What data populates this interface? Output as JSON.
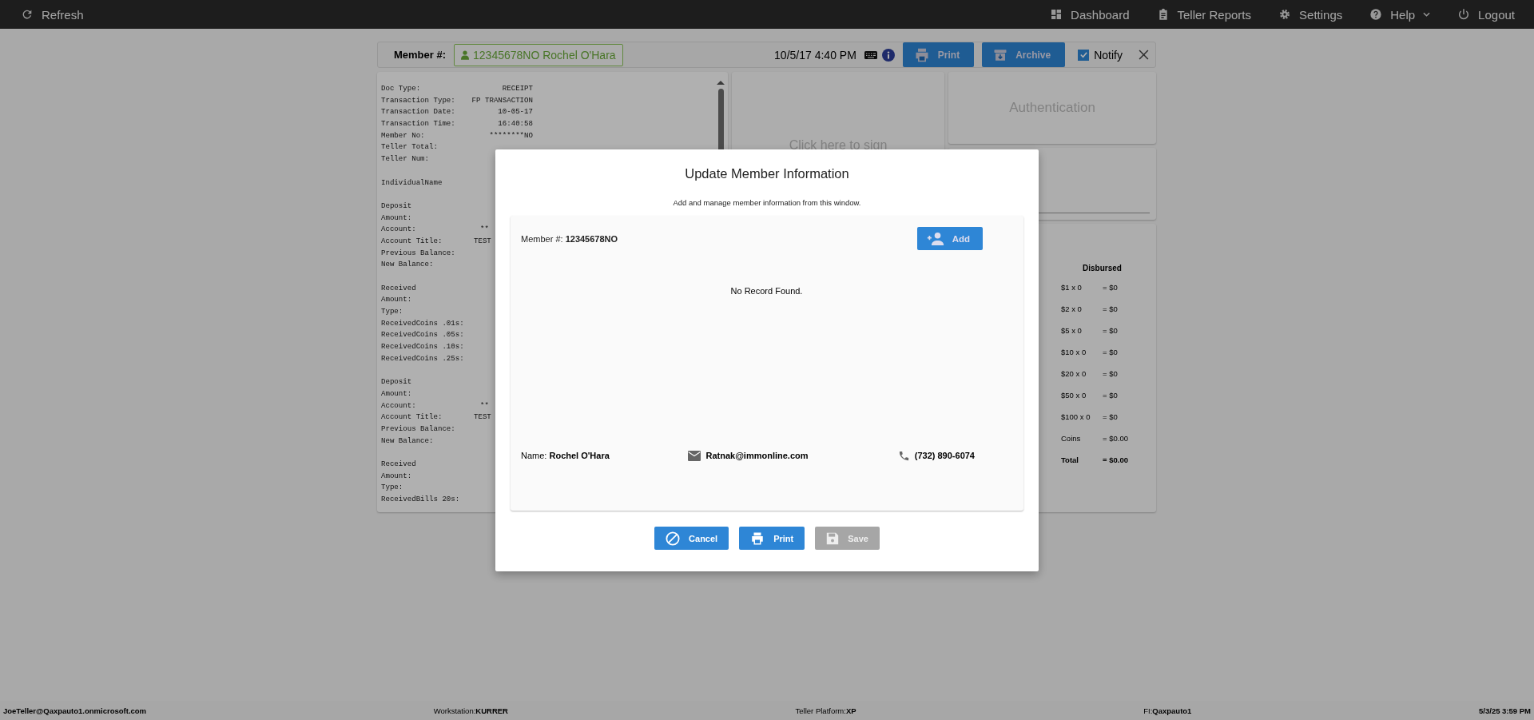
{
  "nav": {
    "left": [
      {
        "label": "Refresh"
      }
    ],
    "right": [
      {
        "label": "Dashboard",
        "has_menu": false
      },
      {
        "label": "Teller Reports",
        "has_menu": false
      },
      {
        "label": "Settings",
        "has_menu": false
      },
      {
        "label": "Help",
        "has_menu": true
      },
      {
        "label": "Logout",
        "has_menu": false
      }
    ]
  },
  "member_bar": {
    "label": "Member #:",
    "member": "12345678NO Rochel O'Hara",
    "datetime": "10/5/17 4:40 PM",
    "buttons": [
      {
        "label": "Print"
      },
      {
        "label": "Archive"
      }
    ],
    "notify": {
      "label": "Notify",
      "checked": true
    }
  },
  "receipt": {
    "sections": [
      [
        {
          "label": "Doc Type:",
          "value": "RECEIPT",
          "kind": "full"
        },
        {
          "label": "Transaction Type:",
          "value": "FP TRANSACTION",
          "kind": "full"
        },
        {
          "label": "Transaction Date:",
          "value": "10-05-17",
          "kind": "full"
        },
        {
          "label": "Transaction Time:",
          "value": "16:40:58",
          "kind": "full"
        },
        {
          "label": "Member No:",
          "value": "********NO",
          "kind": "full"
        },
        {
          "label": "Teller Total:"
        },
        {
          "label": "Teller Num:"
        }
      ],
      [
        {
          "label": "IndividualName"
        }
      ],
      [
        {
          "label": "Deposit"
        },
        {
          "label": "Amount:"
        },
        {
          "label": "Account:",
          "value": "**",
          "kind": "cut"
        },
        {
          "label": "Account Title:",
          "value": "TEST",
          "kind": "cut_far"
        },
        {
          "label": "Previous Balance:"
        },
        {
          "label": "New Balance:"
        }
      ],
      [
        {
          "label": "Received"
        },
        {
          "label": "Amount:"
        },
        {
          "label": "Type:"
        },
        {
          "label": "ReceivedCoins .01s:"
        },
        {
          "label": "ReceivedCoins .05s:"
        },
        {
          "label": "ReceivedCoins .10s:"
        },
        {
          "label": "ReceivedCoins .25s:"
        }
      ],
      [
        {
          "label": "Deposit"
        },
        {
          "label": "Amount:"
        },
        {
          "label": "Account:",
          "value": "**",
          "kind": "cut"
        },
        {
          "label": "Account Title:",
          "value": "TEST",
          "kind": "cut_far"
        },
        {
          "label": "Previous Balance:"
        },
        {
          "label": "New Balance:"
        }
      ],
      [
        {
          "label": "Received"
        },
        {
          "label": "Amount:"
        },
        {
          "label": "Type:"
        },
        {
          "label": "ReceivedBills 20s:"
        }
      ]
    ]
  },
  "sign_panel": {
    "text": "Click here to sign"
  },
  "auth_panel": {
    "text": "Authentication"
  },
  "disbursed": {
    "heading": "Disbursed",
    "rows": [
      {
        "item": "$1 x 0",
        "amount": "= $0",
        "kind": "line"
      },
      {
        "item": "$2 x 0",
        "amount": "= $0",
        "kind": "line"
      },
      {
        "item": "$5 x 0",
        "amount": "= $0",
        "kind": "line"
      },
      {
        "item": "$10 x 0",
        "amount": "= $0",
        "kind": "line"
      },
      {
        "item": "$20 x 0",
        "amount": "= $0",
        "kind": "line"
      },
      {
        "item": "$50 x 0",
        "amount": "= $0",
        "kind": "line"
      },
      {
        "item": "$100 x 0",
        "amount": "= $0",
        "kind": "line"
      },
      {
        "item": "Coins",
        "amount": "= $0.00",
        "kind": "line"
      },
      {
        "item": "Total",
        "amount": "= $0.00",
        "kind": "total"
      }
    ]
  },
  "modal": {
    "title": "Update Member Information",
    "subtitle": "Add and manage member information from this window.",
    "member_label": "Member #:",
    "member_number": "12345678NO",
    "add_button": "Add",
    "empty_message": "No Record Found.",
    "name_label": "Name:",
    "name": "Rochel O'Hara",
    "email": "Ratnak@immonline.com",
    "phone": "(732) 890-6074",
    "buttons": [
      {
        "label": "Cancel",
        "disabled": false
      },
      {
        "label": "Print",
        "disabled": false
      },
      {
        "label": "Save",
        "disabled": true
      }
    ]
  },
  "status_bar": [
    {
      "value": "JoeTeller@Qaxpauto1.onmicrosoft.com"
    },
    {
      "label": "Workstation:",
      "value": "KURRER"
    },
    {
      "label": "Teller Platform:",
      "value": "XP"
    },
    {
      "label": "FI:",
      "value": "Qaxpauto1"
    },
    {
      "value": "5/3/25 3:59 PM"
    }
  ]
}
